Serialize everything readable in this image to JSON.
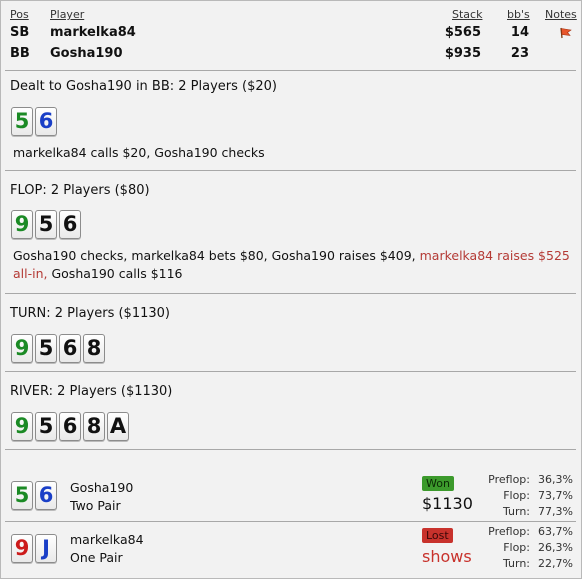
{
  "header": {
    "pos_label": "Pos",
    "player_label": "Player",
    "stack_label": "Stack",
    "bbs_label": "bb's",
    "notes_label": "Notes"
  },
  "players": [
    {
      "pos": "SB",
      "name": "markelka84",
      "stack": "$565",
      "bbs": "14",
      "has_note": true
    },
    {
      "pos": "BB",
      "name": "Gosha190",
      "stack": "$935",
      "bbs": "23",
      "has_note": false
    }
  ],
  "preflop": {
    "title": "Dealt to Gosha190 in BB: 2 Players ($20)",
    "cards": [
      {
        "rank": "5",
        "color": "green"
      },
      {
        "rank": "6",
        "color": "blue"
      }
    ],
    "actions": "markelka84 calls $20, Gosha190 checks"
  },
  "flop": {
    "title": "FLOP: 2 Players ($80)",
    "cards": [
      {
        "rank": "9",
        "color": "green"
      },
      {
        "rank": "5",
        "color": "black"
      },
      {
        "rank": "6",
        "color": "black"
      }
    ],
    "actions_a": "Gosha190 checks, markelka84 bets $80, Gosha190 raises $409, ",
    "actions_red": "markelka84 raises $525 all-in,",
    "actions_b": " Gosha190 calls $116"
  },
  "turn": {
    "title": "TURN: 2 Players ($1130)",
    "cards": [
      {
        "rank": "9",
        "color": "green"
      },
      {
        "rank": "5",
        "color": "black"
      },
      {
        "rank": "6",
        "color": "black"
      },
      {
        "rank": "8",
        "color": "black"
      }
    ]
  },
  "river": {
    "title": "RIVER: 2 Players ($1130)",
    "cards": [
      {
        "rank": "9",
        "color": "green"
      },
      {
        "rank": "5",
        "color": "black"
      },
      {
        "rank": "6",
        "color": "black"
      },
      {
        "rank": "8",
        "color": "black"
      },
      {
        "rank": "A",
        "color": "black"
      }
    ]
  },
  "showdown": [
    {
      "name": "Gosha190",
      "hand": "Two Pair",
      "cards": [
        {
          "rank": "5",
          "color": "green"
        },
        {
          "rank": "6",
          "color": "blue"
        }
      ],
      "result": "Won",
      "amount": "$1130",
      "preflop_label": "Preflop:",
      "preflop": "36,3%",
      "flop_label": "Flop:",
      "flop": "73,7%",
      "turn_label": "Turn:",
      "turn": "77,3%"
    },
    {
      "name": "markelka84",
      "hand": "One Pair",
      "cards": [
        {
          "rank": "9",
          "color": "red"
        },
        {
          "rank": "J",
          "color": "blue"
        }
      ],
      "result": "Lost",
      "amount": "shows",
      "preflop_label": "Preflop:",
      "preflop": "63,7%",
      "flop_label": "Flop:",
      "flop": "26,3%",
      "turn_label": "Turn:",
      "turn": "22,7%"
    }
  ],
  "colors": {
    "won_badge": "#3c9a2c",
    "lost_badge": "#c8322c",
    "lost_text": "#c8322c",
    "all_in_text": "#b43a35",
    "card_green": "#1b8a25",
    "card_blue": "#1a3fc7",
    "card_red": "#cc1b1b"
  }
}
